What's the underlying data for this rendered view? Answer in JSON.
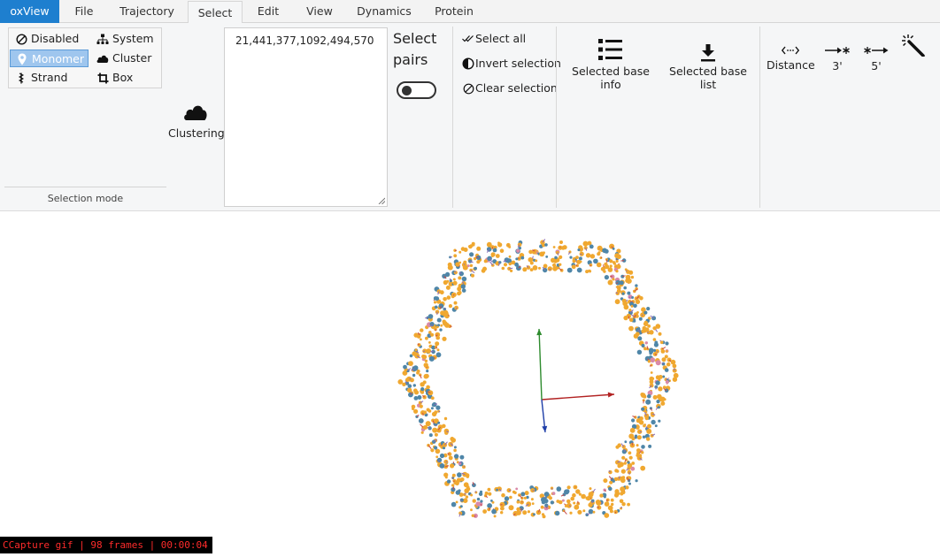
{
  "tabs": [
    {
      "label": "oxView"
    },
    {
      "label": "File"
    },
    {
      "label": "Trajectory"
    },
    {
      "label": "Select"
    },
    {
      "label": "Edit"
    },
    {
      "label": "View"
    },
    {
      "label": "Dynamics"
    },
    {
      "label": "Protein"
    }
  ],
  "selection_mode": {
    "label": "Selection mode",
    "options": [
      {
        "label": "Disabled",
        "icon": "disabled-icon"
      },
      {
        "label": "System",
        "icon": "system-icon"
      },
      {
        "label": "Monomer",
        "icon": "monomer-icon",
        "selected": true
      },
      {
        "label": "Cluster",
        "icon": "cluster-icon"
      },
      {
        "label": "Strand",
        "icon": "strand-icon"
      },
      {
        "label": "Box",
        "icon": "crop-icon"
      }
    ]
  },
  "clustering": {
    "label": "Clustering"
  },
  "selected_ids": {
    "value": "21,441,377,1092,494,570"
  },
  "select_pairs": {
    "label": "Select pairs",
    "enabled": false
  },
  "selection_actions": [
    {
      "label": "Select all",
      "icon": "check-all-icon"
    },
    {
      "label": "Invert selection",
      "icon": "invert-icon"
    },
    {
      "label": "Clear selection",
      "icon": "clear-icon"
    }
  ],
  "info_buttons": [
    {
      "label": "Selected base info",
      "icon": "list-icon"
    },
    {
      "label": "Selected base list",
      "icon": "download-icon"
    }
  ],
  "tools": [
    {
      "label": "Distance",
      "icon": "distance-icon"
    },
    {
      "label": "3'",
      "icon": "extend-3-icon"
    },
    {
      "label": "5'",
      "icon": "extend-5-icon"
    },
    {
      "label": "",
      "icon": "magic-wand-icon"
    }
  ],
  "capture": {
    "text": "CCapture gif | 98 frames | 00:00:04"
  },
  "colors": {
    "brand": "#1e7fcf",
    "selected": "#9fc6ee",
    "axis_x": "#b22222",
    "axis_y": "#2e8b2e",
    "axis_z": "#1f3fa8",
    "strand_orange": "#f0a830",
    "strand_blue": "#4f86a8"
  }
}
